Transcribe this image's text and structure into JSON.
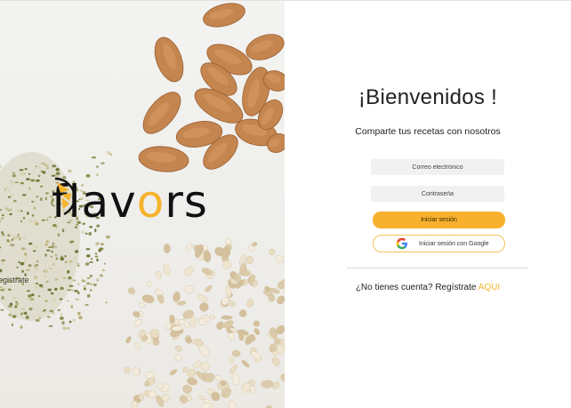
{
  "brand": {
    "logo_prefix": "flav",
    "logo_accent": "o",
    "logo_suffix": "rs",
    "accent_color": "#f4b32b"
  },
  "background": {
    "peek_text": "egistrate"
  },
  "login": {
    "title": "¡Bienvenidos !",
    "subtitle": "Comparte tus recetas con nosotros",
    "email_placeholder": "Correo electrónico",
    "password_placeholder": "Contraseña",
    "login_button": "Iniciar sesión",
    "google_button": "Iniciar sesión con Google",
    "google_icon": "google-icon",
    "signup_prompt": "¿No tienes cuenta? Regístrate",
    "signup_link": "AQUI",
    "button_color": "#f7b12f"
  }
}
